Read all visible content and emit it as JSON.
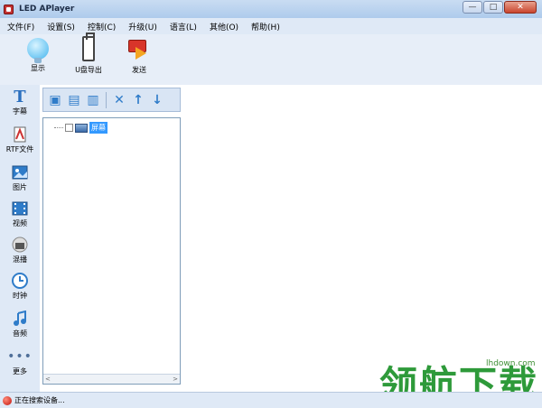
{
  "window": {
    "title": "LED APlayer",
    "minimize": "—",
    "maximize": "□",
    "close": "✕"
  },
  "menu": [
    "文件(F)",
    "设置(S)",
    "控制(C)",
    "升级(U)",
    "语言(L)",
    "其他(O)",
    "帮助(H)"
  ],
  "toolbar": {
    "display_label": "显示",
    "usb_export_label": "U盘导出",
    "send_label": "发送"
  },
  "sidebar": {
    "items": [
      {
        "label": "字幕",
        "icon": "text-icon"
      },
      {
        "label": "RTF文件",
        "icon": "rtf-file-icon"
      },
      {
        "label": "图片",
        "icon": "picture-icon"
      },
      {
        "label": "视频",
        "icon": "video-icon"
      },
      {
        "label": "混播",
        "icon": "mixed-play-icon"
      },
      {
        "label": "时钟",
        "icon": "clock-icon"
      },
      {
        "label": "音频",
        "icon": "audio-icon"
      },
      {
        "label": "更多",
        "icon": "more-icon"
      }
    ]
  },
  "panel_toolbar": {
    "new_program": "▣",
    "new_page": "▤",
    "new_window": "▥",
    "delete": "✕",
    "move_up": "↑",
    "move_down": "↓"
  },
  "tree": {
    "root_label": "屏幕"
  },
  "scroll": {
    "left": "<",
    "right": ">"
  },
  "status": {
    "text": "正在搜索设备..."
  },
  "watermark": {
    "url": "lhdown.com",
    "text": "领航下载"
  }
}
